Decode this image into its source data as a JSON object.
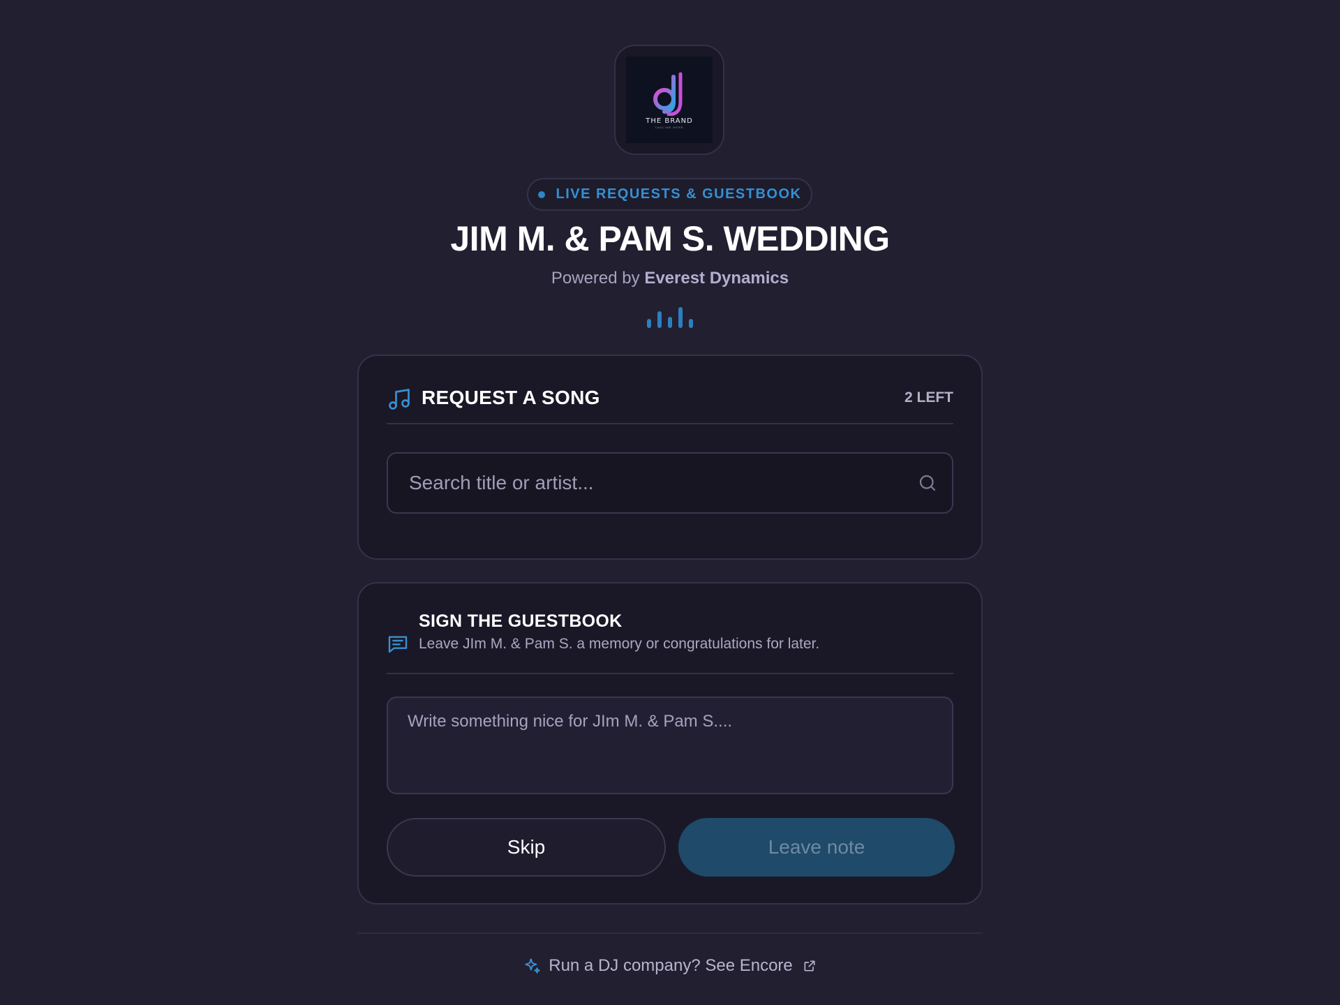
{
  "header": {
    "logo": {
      "brand_text": "THE BRAND",
      "tagline": "TAGLINE HERE"
    },
    "live_pill": "LIVE REQUESTS & GUESTBOOK",
    "event_title": "JIM M. & PAM S. WEDDING",
    "powered_prefix": "Powered by",
    "powered_company": "Everest Dynamics",
    "equalizer_levels": [
      0.4,
      0.75,
      0.5,
      0.95,
      0.4
    ]
  },
  "song_request": {
    "title": "REQUEST A SONG",
    "remaining": "2 LEFT",
    "search_placeholder": "Search title or artist..."
  },
  "guestbook": {
    "title": "SIGN THE GUESTBOOK",
    "subtitle": "Leave JIm M. & Pam S. a memory or congratulations for later.",
    "note_placeholder": "Write something nice for JIm M. & Pam S....",
    "skip_label": "Skip",
    "leave_label": "Leave note"
  },
  "footer": {
    "link_text": "Run a DJ company? See Encore"
  },
  "colors": {
    "background": "#221f30",
    "card": "#1a1826",
    "accent_blue": "#3391d4",
    "leave_button_disabled": "#1f4a69",
    "logo_gradient_start": "#e04bd0",
    "logo_gradient_end": "#2aa6e6"
  },
  "icons": {
    "music": "music-note-icon",
    "search": "search-icon",
    "chat": "chat-bubble-icon",
    "sparkle": "sparkle-icon",
    "external": "external-link-icon"
  }
}
